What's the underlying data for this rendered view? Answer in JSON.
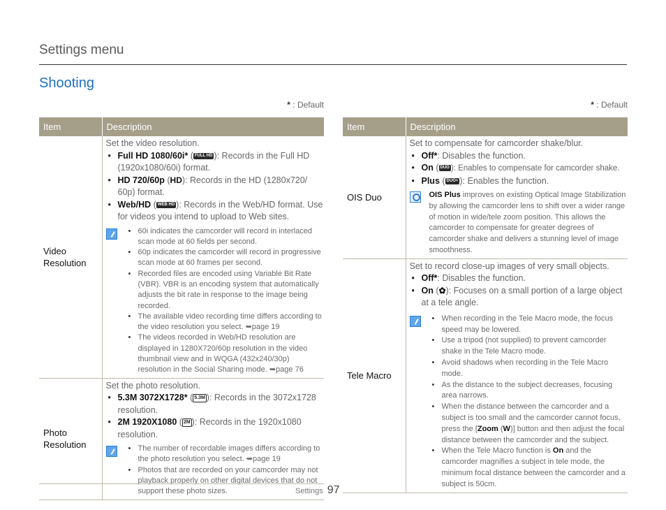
{
  "header": {
    "title": "Settings menu"
  },
  "section": {
    "title": "Shooting"
  },
  "default_note": {
    "star": "*",
    "label": " : Default"
  },
  "table_headers": {
    "item": "Item",
    "description": "Description"
  },
  "left_rows": [
    {
      "item": "Video Resolution",
      "intro": "Set the video resolution.",
      "options": [
        {
          "name": "Full HD 1080/60i*",
          "icon": "full-hd-icon",
          "icon_text": "FULL HD",
          "text": "): Records in the Full HD (1920x1080/60i) format."
        },
        {
          "name": "HD 720/60p",
          "icon": "hd-icon",
          "icon_text": "HD",
          "text": "): Records in the HD (1280x720/ 60p) format."
        },
        {
          "name": "Web/HD",
          "icon": "web-hd-icon",
          "icon_text": "WEB HD",
          "text": "): Records in the Web/HD format. Use for videos you intend to upload to Web sites."
        }
      ],
      "notes": [
        "60i indicates the camcorder will record in interlaced scan mode at 60 fields per second.",
        "60p indicates the camcorder will record in progressive scan mode at 60 frames per second.",
        "Recorded files are encoded using Variable Bit Rate (VBR). VBR is an encoding system that automatically adjusts the bit rate in response to the image being recorded.",
        "The available video recording time differs according to the video resolution you select. ➥page 19",
        "The videos recorded in Web/HD resolution are displayed in 1280X720/60p resolution in the video thumbnail view and in WQGA (432x240/30p) resolution in the Social Sharing mode. ➥page 76"
      ]
    },
    {
      "item": "Photo Resolution",
      "intro": "Set the photo resolution.",
      "options": [
        {
          "name": "5.3M 3072X1728*",
          "icon": "photo-5-3m-icon",
          "icon_text": "5.3M",
          "text": "): Records in the 3072x1728 resolution."
        },
        {
          "name": "2M 1920X1080",
          "icon": "photo-2m-icon",
          "icon_text": "2M",
          "text": "): Records in the 1920x1080 resolution."
        }
      ],
      "notes": [
        "The number of recordable images differs according to the photo resolution you select. ➥page 19",
        "Photos that are recorded on your camcorder may not playback properly on other digital devices that do not support these photo sizes."
      ]
    }
  ],
  "right_rows": [
    {
      "item": "OIS Duo",
      "intro": "Set to compensate for camcorder shake/blur.",
      "options": [
        {
          "name": "Off*",
          "text": ": Disables the function."
        },
        {
          "name": "On",
          "icon": "ois-on-icon",
          "icon_text": "DUO",
          "text": "): Enables to compensate for camcorder shake."
        },
        {
          "name": "Plus",
          "icon": "ois-plus-icon",
          "icon_text": "DUO+",
          "text": "): Enables the function."
        }
      ],
      "tip": {
        "bold": "OIS Plus",
        "text": " improves on existing Optical Image Stabilization by allowing the camcorder lens to shift over a wider range of motion in wide/tele zoom position. This allows the camcorder to compensate for greater degrees of camcorder shake and delivers a stunning level of image smoothness."
      }
    },
    {
      "item": "Tele Macro",
      "intro": "Set to record close-up images of very small objects.",
      "options": [
        {
          "name": "Off*",
          "text": ": Disables the function."
        },
        {
          "name": "On",
          "icon": "tele-macro-icon",
          "icon_text": "✿",
          "text": "): Focuses on a small portion of a large object at a tele angle."
        }
      ],
      "notes": [
        "When recording in the Tele Macro mode, the focus speed may be lowered.",
        "Use a tripod (not supplied) to prevent camcorder shake in the Tele Macro mode.",
        "Avoid shadows when recording in the Tele Macro mode.",
        "As the distance to the subject decreases, focusing area narrows."
      ],
      "note_zoom": {
        "pre": "When the distance between the camcorder and a subject is too small and the camcorder cannot focus, press the [",
        "zoom": "Zoom",
        "mid": " (",
        "w": "W",
        "post": ")] button and then adjust the focal distance between the camcorder and the subject."
      },
      "note_on": {
        "pre": "When the Tele Macro function is ",
        "on": "On",
        "post": " and the camcorder magnifies a subject in tele mode, the minimum focal distance between the camcorder and a subject is 50cm."
      }
    }
  ],
  "footer": {
    "section": "Settings",
    "page": "97"
  }
}
